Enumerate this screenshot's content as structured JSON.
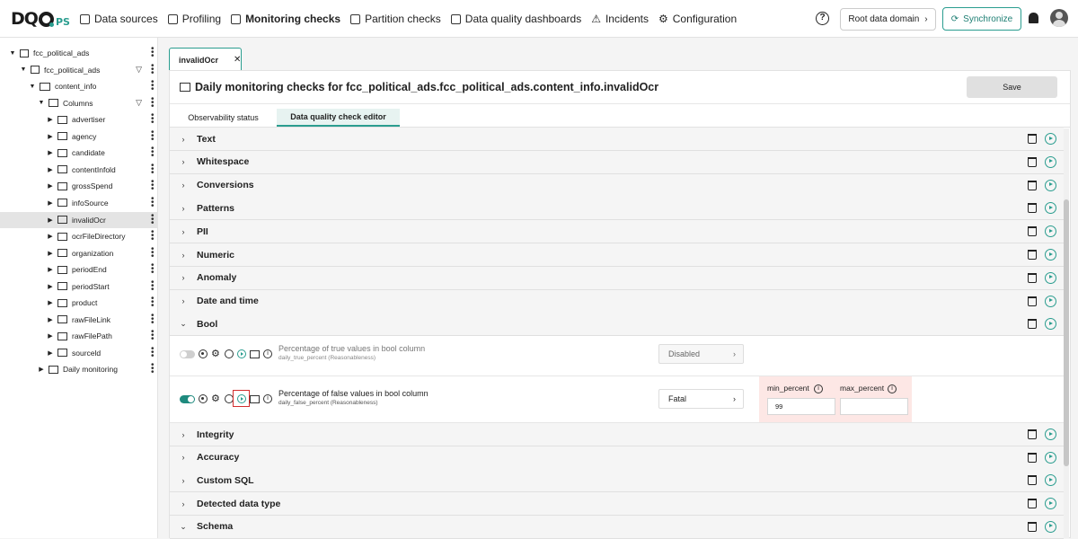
{
  "logo": {
    "text": "DQ",
    "suffix": "PS"
  },
  "nav": [
    {
      "label": "Data sources",
      "icon": "data-sources-icon",
      "active": false
    },
    {
      "label": "Profiling",
      "icon": "profiling-icon",
      "active": false
    },
    {
      "label": "Monitoring checks",
      "icon": "monitoring-icon",
      "active": true
    },
    {
      "label": "Partition checks",
      "icon": "partition-icon",
      "active": false
    },
    {
      "label": "Data quality dashboards",
      "icon": "dashboards-icon",
      "active": false
    },
    {
      "label": "Incidents",
      "icon": "incidents-icon",
      "active": false
    },
    {
      "label": "Configuration",
      "icon": "configuration-icon",
      "active": false
    }
  ],
  "header": {
    "help": "?",
    "domain_button": "Root data domain",
    "sync_button": "Synchronize"
  },
  "sidebar": {
    "items": [
      {
        "label": "fcc_political_ads",
        "level": 0,
        "caret": "▼"
      },
      {
        "label": "fcc_political_ads",
        "level": 1,
        "caret": "▼"
      },
      {
        "label": "content_info",
        "level": 2,
        "caret": "▼"
      },
      {
        "label": "Columns",
        "level": 3,
        "caret": "▼"
      },
      {
        "label": "advertiser",
        "level": 4,
        "caret": "▶"
      },
      {
        "label": "agency",
        "level": 4,
        "caret": "▶"
      },
      {
        "label": "candidate",
        "level": 4,
        "caret": "▶"
      },
      {
        "label": "contentInfold",
        "level": 4,
        "caret": "▶"
      },
      {
        "label": "grossSpend",
        "level": 4,
        "caret": "▶"
      },
      {
        "label": "infoSource",
        "level": 4,
        "caret": "▶"
      },
      {
        "label": "invalidOcr",
        "level": 4,
        "caret": "▶",
        "selected": true
      },
      {
        "label": "ocrFileDirectory",
        "level": 4,
        "caret": "▶"
      },
      {
        "label": "organization",
        "level": 4,
        "caret": "▶"
      },
      {
        "label": "periodEnd",
        "level": 4,
        "caret": "▶"
      },
      {
        "label": "periodStart",
        "level": 4,
        "caret": "▶"
      },
      {
        "label": "product",
        "level": 4,
        "caret": "▶"
      },
      {
        "label": "rawFileLink",
        "level": 4,
        "caret": "▶"
      },
      {
        "label": "rawFilePath",
        "level": 4,
        "caret": "▶"
      },
      {
        "label": "sourceld",
        "level": 4,
        "caret": "▶"
      },
      {
        "label": "Daily monitoring",
        "level": 3,
        "caret": "▶"
      }
    ]
  },
  "main": {
    "open_tab": {
      "label": "invalidOcr",
      "close": "✕"
    },
    "title": "Daily monitoring checks for fcc_political_ads.fcc_political_ads.content_info.invalidOcr",
    "save_label": "Save",
    "subtabs": [
      {
        "label": "Observability status",
        "active": false
      },
      {
        "label": "Data quality check editor",
        "active": true
      }
    ],
    "categories_top": [
      "Text",
      "Whitespace",
      "Conversions",
      "Patterns",
      "PII",
      "Numeric",
      "Anomaly",
      "Date and time",
      "Bool"
    ],
    "checks": [
      {
        "name": "Percentage of true values in bool column",
        "subname": "daily_true_percent (Reasonableness)",
        "enabled": false,
        "severity": "Disabled"
      },
      {
        "name": "Percentage of false values in bool column",
        "subname": "daily_false_percent (Reasonableness)",
        "enabled": true,
        "severity": "Fatal",
        "rule": {
          "min_label": "min_percent",
          "min_value": "99",
          "max_label": "max_percent",
          "max_value": ""
        }
      }
    ],
    "categories_bottom": [
      "Integrity",
      "Accuracy",
      "Custom SQL",
      "Detected data type",
      "Schema"
    ]
  },
  "colors": {
    "accent": "#2a9d8f",
    "highlight": "#d32f2f",
    "rule_bg": "#fde7e5"
  }
}
